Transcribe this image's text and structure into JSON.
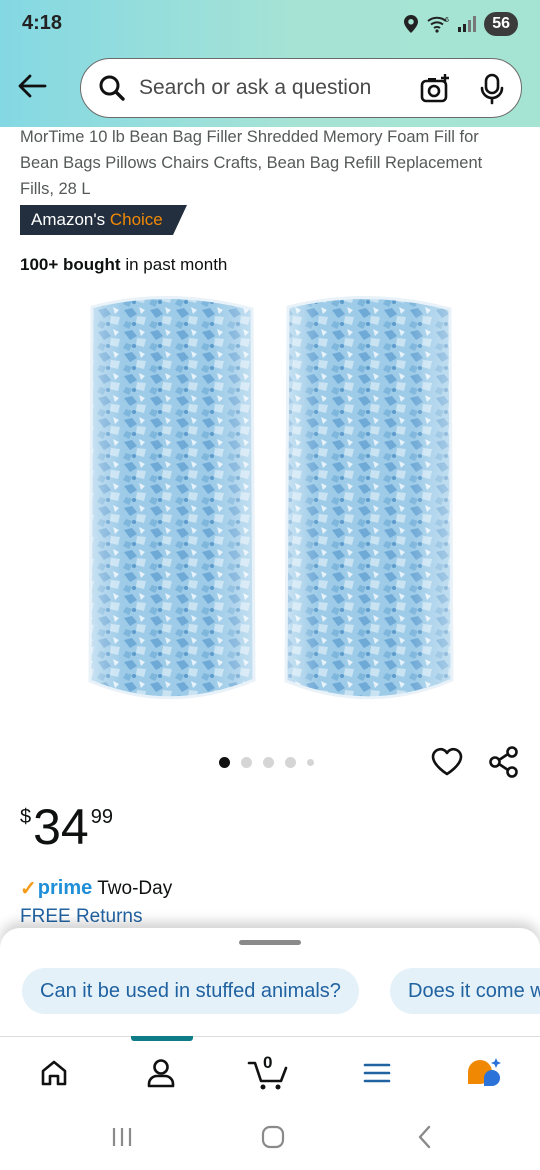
{
  "status": {
    "time": "4:18",
    "battery": "56"
  },
  "search": {
    "placeholder": "Search or ask a question"
  },
  "product": {
    "title": "MorTime 10 lb Bean Bag Filler Shredded Memory Foam Fill for Bean Bags Pillows Chairs Crafts, Bean Bag Refill Replacement Fills, 28 L",
    "badge_prefix": "Amazon's",
    "badge_highlight": "Choice",
    "bought_bold": "100+ bought",
    "bought_rest": " in past month",
    "image_count": 5,
    "active_image": 1
  },
  "price": {
    "currency": "$",
    "whole": "34",
    "fraction": "99"
  },
  "delivery": {
    "prime": "prime",
    "speed": "Two-Day",
    "returns": "FREE Returns"
  },
  "questions": [
    "Can it be used in stuffed animals?",
    "Does it come w"
  ],
  "nav": {
    "cart_count": "0"
  },
  "colors": {
    "accent": "#2162a1",
    "badge_bg": "#232f3e",
    "badge_highlight": "#f08804",
    "prime": "#1f8fd8",
    "nav_indicator": "#0e7c86"
  }
}
